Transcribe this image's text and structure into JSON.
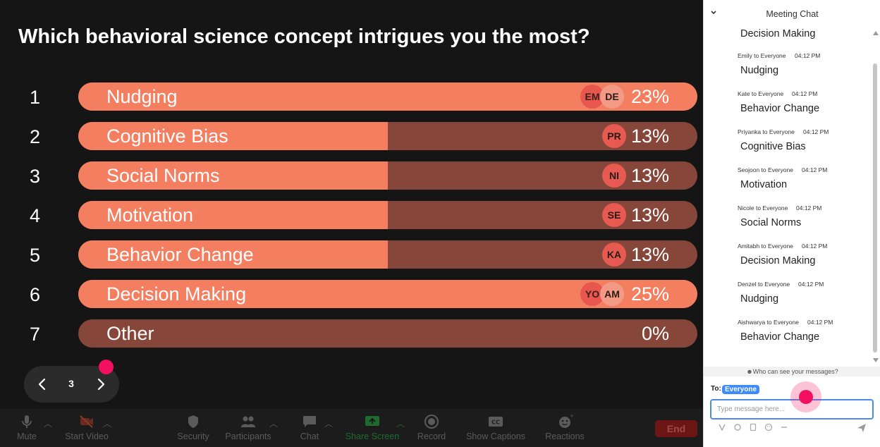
{
  "poll": {
    "question": "Which behavioral science concept intrigues you the most?",
    "rows": [
      {
        "num": "1",
        "label": "Nudging",
        "percent_text": "23%",
        "fill": 1.0,
        "avatars": [
          "EM",
          "DE"
        ]
      },
      {
        "num": "2",
        "label": "Cognitive Bias",
        "percent_text": "13%",
        "fill": 0.5,
        "avatars": [
          "PR"
        ]
      },
      {
        "num": "3",
        "label": "Social Norms",
        "percent_text": "13%",
        "fill": 0.5,
        "avatars": [
          "NI"
        ]
      },
      {
        "num": "4",
        "label": "Motivation",
        "percent_text": "13%",
        "fill": 0.5,
        "avatars": [
          "SE"
        ]
      },
      {
        "num": "5",
        "label": "Behavior Change",
        "percent_text": "13%",
        "fill": 0.5,
        "avatars": [
          "KA"
        ]
      },
      {
        "num": "6",
        "label": "Decision Making",
        "percent_text": "25%",
        "fill": 1.0,
        "avatars": [
          "YO",
          "AM"
        ]
      },
      {
        "num": "7",
        "label": "Other",
        "percent_text": "0%",
        "fill": 0.0,
        "avatars": []
      }
    ]
  },
  "pager": {
    "page": "3"
  },
  "toolbar": {
    "mute": "Mute",
    "start_video": "Start Video",
    "security": "Security",
    "participants": "Participants",
    "chat": "Chat",
    "share_screen": "Share Screen",
    "record": "Record",
    "show_captions": "Show Captions",
    "reactions": "Reactions",
    "end": "End"
  },
  "chat": {
    "title": "Meeting Chat",
    "messages": [
      {
        "sender": "",
        "time": "",
        "text": "Decision Making"
      },
      {
        "sender": "Emily to Everyone",
        "time": "04:12 PM",
        "text": "Nudging"
      },
      {
        "sender": "Kate to Everyone",
        "time": "04:12 PM",
        "text": "Behavior Change"
      },
      {
        "sender": "Priyanka to Everyone",
        "time": "04:12 PM",
        "text": "Cognitive Bias"
      },
      {
        "sender": "Seojoon to Everyone",
        "time": "04:12 PM",
        "text": "Motivation"
      },
      {
        "sender": "Nicole to Everyone",
        "time": "04:12 PM",
        "text": "Social Norms"
      },
      {
        "sender": "Amitabh to Everyone",
        "time": "04:12 PM",
        "text": "Decision Making"
      },
      {
        "sender": "Denzel to Everyone",
        "time": "04:12 PM",
        "text": "Nudging"
      },
      {
        "sender": "Aishwarya to Everyone",
        "time": "04:12 PM",
        "text": "Behavior Change"
      }
    ],
    "who_can_see": "Who can see your messages?",
    "to_label": "To:",
    "to_value": "Everyone",
    "input_placeholder": "Type message here..."
  },
  "colors": {
    "bar_fill": "#f47e60",
    "bar_track": "#86473a",
    "accent_pink": "#f2105f",
    "share_green": "#1f8f3a",
    "end_red": "#6e1616"
  }
}
